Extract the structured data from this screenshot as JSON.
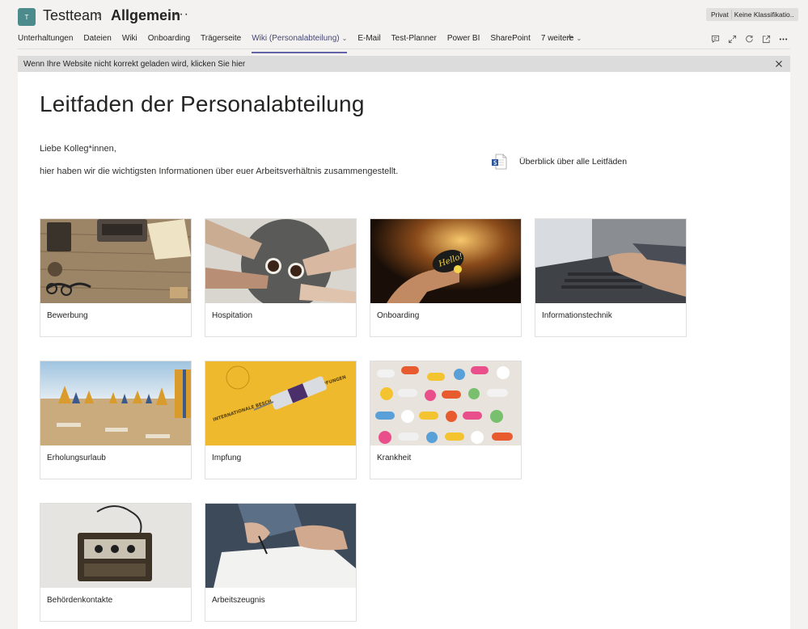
{
  "header": {
    "avatar_initial": "T",
    "team_name": "Testteam",
    "separator": "›",
    "channel_name": "Allgemein",
    "more": "···",
    "privacy": "Privat",
    "classification": "Keine Klassifikatio.."
  },
  "tabs": [
    {
      "label": "Unterhaltungen"
    },
    {
      "label": "Dateien"
    },
    {
      "label": "Wiki"
    },
    {
      "label": "Onboarding"
    },
    {
      "label": "Trägerseite"
    },
    {
      "label": "Wiki (Personalabteilung)",
      "active": true
    },
    {
      "label": "E-Mail"
    },
    {
      "label": "Test-Planner"
    },
    {
      "label": "Power BI"
    },
    {
      "label": "SharePoint"
    },
    {
      "label": "7 weitere"
    }
  ],
  "header_icons": [
    "conversation-icon",
    "expand-icon",
    "reload-icon",
    "open-external-icon",
    "more-options-icon"
  ],
  "banner": {
    "text": "Wenn Ihre Website nicht korrekt geladen wird, klicken Sie hier"
  },
  "page": {
    "title": "Leitfaden der Personalabteilung",
    "greeting": "Liebe Kolleg*innen,",
    "intro": "hier haben wir die wichtigsten Informationen über euer Arbeitsverhältnis zusammengestellt.",
    "doc_link": "Überblick über alle Leitfäden"
  },
  "cards": [
    {
      "label": "Bewerbung"
    },
    {
      "label": "Hospitation"
    },
    {
      "label": "Onboarding"
    },
    {
      "label": "Informationstechnik"
    },
    {
      "label": "Erholungsurlaub"
    },
    {
      "label": "Impfung"
    },
    {
      "label": "Krankheit"
    },
    {
      "label": "Behördenkontakte"
    },
    {
      "label": "Arbeitszeugnis"
    }
  ],
  "image_text": {
    "hello": "Hello!",
    "vaccine": "INTERNATIONALE BESCHEINIGUNGEN ÜBER IMPFUNGEN"
  },
  "colors": {
    "accent": "#6264a7",
    "team_avatar": "#4c8b8b"
  }
}
